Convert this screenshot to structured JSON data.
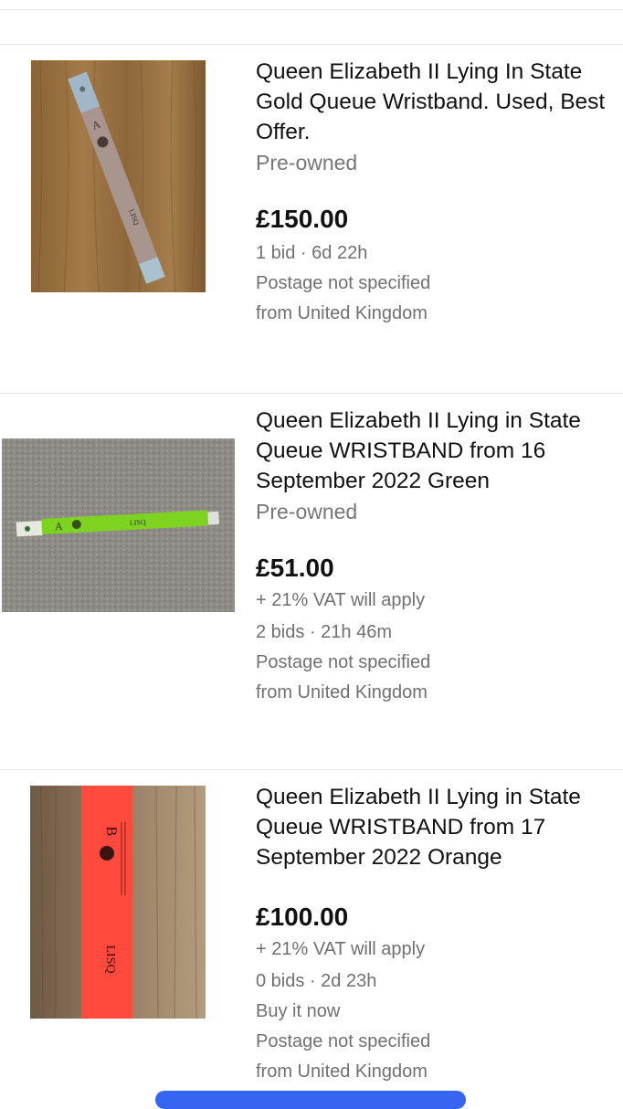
{
  "listings": [
    {
      "title": "Queen Elizabeth II Lying In State Gold Queue Wristband. Used, Best Offer.",
      "condition": "Pre-owned",
      "price": "£150.00",
      "vat": "",
      "bids": "1 bid · 6d 22h",
      "buy_now": "",
      "postage": "Postage not specified",
      "location": "from United Kingdom",
      "image": {
        "desc": "gold-wristband-on-wood",
        "letters": "A",
        "tag": "LISQ"
      }
    },
    {
      "title": "Queen Elizabeth II Lying in State Queue WRISTBAND from 16 September 2022  Green",
      "condition": "Pre-owned",
      "price": "£51.00",
      "vat": "+ 21% VAT will apply",
      "bids": "2 bids · 21h 46m",
      "buy_now": "",
      "postage": "Postage not specified",
      "location": "from United Kingdom",
      "image": {
        "desc": "green-wristband-on-carpet",
        "letters": "A",
        "tag": "LISQ"
      }
    },
    {
      "title": "Queen Elizabeth II Lying in State Queue WRISTBAND from 17 September 2022 Orange",
      "condition": "",
      "price": "£100.00",
      "vat": "+ 21% VAT will apply",
      "bids": "0 bids · 2d 23h",
      "buy_now": "Buy it now",
      "postage": "Postage not specified",
      "location": "from United Kingdom",
      "image": {
        "desc": "orange-wristband-on-wood",
        "letters": "B",
        "tag": "LISQ"
      }
    }
  ],
  "colors": {
    "price": "#111111",
    "secondary": "#767676",
    "divider": "#e6e6e6",
    "accent_pill": "#3665f3"
  }
}
